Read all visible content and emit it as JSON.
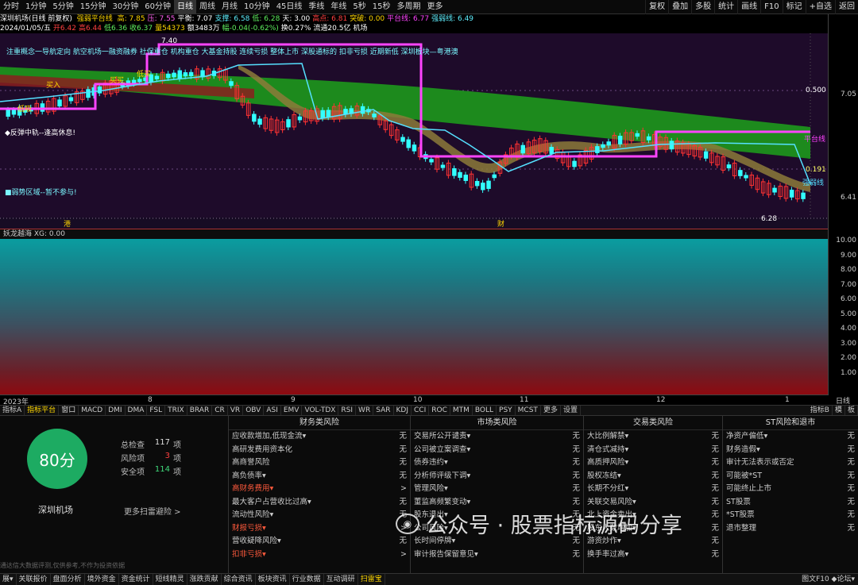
{
  "toolbar": {
    "timeframes": [
      "分时",
      "1分钟",
      "5分钟",
      "15分钟",
      "30分钟",
      "60分钟",
      "日线",
      "周线",
      "月线",
      "10分钟",
      "45日线",
      "季线",
      "年线",
      "5秒",
      "15秒",
      "多周期",
      "更多"
    ],
    "active_timeframe": 6,
    "right_tools": [
      "复权",
      "叠加",
      "多股",
      "统计",
      "画线",
      "F10",
      "标记",
      "+自选",
      "返回"
    ]
  },
  "status_line1": {
    "stock": "深圳机场(日线 前复权)",
    "indicator": "强弱平台线",
    "items": [
      {
        "t": "高: 7.85",
        "c": "#ffd700"
      },
      {
        "t": "压: 7.55",
        "c": "#ff5ff0"
      },
      {
        "t": "平衡: 7.07",
        "c": "#ffffff"
      },
      {
        "t": "支撑: 6.58",
        "c": "#5ff0ff"
      },
      {
        "t": "低: 6.28",
        "c": "#5ff05f"
      },
      {
        "t": "天: 3.00",
        "c": "#ffffff"
      },
      {
        "t": "高点: 6.81",
        "c": "#ff4040"
      },
      {
        "t": "突破: 0.00",
        "c": "#ffd700"
      },
      {
        "t": "平台线: 6.77",
        "c": "#ff44ff"
      },
      {
        "t": "强弱线: 6.49",
        "c": "#5ff0ff"
      }
    ]
  },
  "status_line2": {
    "items": [
      {
        "t": "2024/01/05/五",
        "c": "#ffffff"
      },
      {
        "t": "开6.42",
        "c": "#ff4040"
      },
      {
        "t": "高6.44",
        "c": "#ff4040"
      },
      {
        "t": "低6.36",
        "c": "#5ff05f"
      },
      {
        "t": "收6.37",
        "c": "#5ff05f"
      },
      {
        "t": "量54373",
        "c": "#ffd700"
      },
      {
        "t": "额3483万",
        "c": "#ffffff"
      },
      {
        "t": "幅-0.04(-0.62%)",
        "c": "#5ff05f"
      },
      {
        "t": "换0.27%",
        "c": "#ffffff"
      },
      {
        "t": "流通20.5亿",
        "c": "#ffffff"
      },
      {
        "t": "机场",
        "c": "#ffffff"
      }
    ]
  },
  "main_chart": {
    "y_ticks": [
      "7.05",
      "6.41"
    ],
    "annotations": {
      "hi_price": "7.40",
      "lo_price": "6.28",
      "val_0500": "0.500",
      "val_0191": "0.191",
      "platform_label": "平台线",
      "strong_label": "强弱线",
      "ticker_text": "注重概念一导航定向 航空机场一融资融券 社保重仓 机构重仓 大基金持股 连续亏损 整体上市 深股通标的 扣非亏损 近期新低 深圳板块—粤港澳",
      "rebound_text": "◆反弹中轨--逢高休息!",
      "weak_text": "■弱势区域--暂不参与!",
      "buy1": "低吸",
      "buy2": "买入",
      "buy3": "买买",
      "buy4": "低买",
      "x_mark1": "港",
      "x_mark2": "财"
    }
  },
  "sub_chart": {
    "title": "妖龙越海 XG: 0.00",
    "y_ticks": [
      "10.00",
      "9.00",
      "8.00",
      "7.00",
      "6.00",
      "5.00",
      "4.00",
      "3.00",
      "2.00",
      "1.00"
    ]
  },
  "x_axis": {
    "labels": [
      "2023年",
      "8",
      "9",
      "10",
      "11",
      "12",
      "1"
    ],
    "tag": "日线"
  },
  "indicator_tabs": {
    "items": [
      "指标A",
      "指标平台",
      "窗口",
      "MACD",
      "DMI",
      "DMA",
      "FSL",
      "TRIX",
      "BRAR",
      "CR",
      "VR",
      "OBV",
      "ASI",
      "EMV",
      "VOL-TDX",
      "RSI",
      "WR",
      "SAR",
      "KDJ",
      "CCI",
      "ROC",
      "MTM",
      "BOLL",
      "PSY",
      "MCST",
      "更多",
      "设置"
    ],
    "active": 1,
    "right": [
      "指标B",
      "模",
      "板"
    ]
  },
  "risk_panel": {
    "score": "80分",
    "stock_name": "深圳机场",
    "summary": [
      {
        "label": "总检查",
        "value": "117",
        "unit": "项",
        "color": "#dddddd"
      },
      {
        "label": "风险项",
        "value": "3",
        "unit": "项",
        "color": "#ff4040"
      },
      {
        "label": "安全项",
        "value": "114",
        "unit": "项",
        "color": "#3fd87a"
      }
    ],
    "more_scan": "更多扫雷避险 >",
    "disclaimer": "通达信大数据评测,仅供参考,不作为投资依据",
    "columns": [
      {
        "title": "财务类风险",
        "items": [
          {
            "n": "应收款增加,低现金流▾",
            "v": "无",
            "warn": false
          },
          {
            "n": "高研发费用资本化",
            "v": "无",
            "warn": false
          },
          {
            "n": "高商誉风险",
            "v": "无",
            "warn": false
          },
          {
            "n": "高负债率▾",
            "v": "无",
            "warn": false
          },
          {
            "n": "高财务费用▾",
            "v": ">",
            "warn": true
          },
          {
            "n": "最大客户占营收比过高▾",
            "v": "无",
            "warn": false
          },
          {
            "n": "流动性风险▾",
            "v": "无",
            "warn": false
          },
          {
            "n": "财报亏损▾",
            "v": ">",
            "warn": true
          },
          {
            "n": "营收疑降风险▾",
            "v": "无",
            "warn": false
          },
          {
            "n": "扣非亏损▾",
            "v": ">",
            "warn": true
          }
        ]
      },
      {
        "title": "市场类风险",
        "items": [
          {
            "n": "交易所公开谴责▾",
            "v": "无",
            "warn": false
          },
          {
            "n": "公司被立案调查▾",
            "v": "无",
            "warn": false
          },
          {
            "n": "债券违约▾",
            "v": "无",
            "warn": false
          },
          {
            "n": "分析师评级下调▾",
            "v": "无",
            "warn": false
          },
          {
            "n": "管理风险▾",
            "v": "无",
            "warn": false
          },
          {
            "n": "董监高频繁变动▾",
            "v": "无",
            "warn": false
          },
          {
            "n": "股东退出▾",
            "v": "无",
            "warn": false
          },
          {
            "n": "公司风险▾",
            "v": "无",
            "warn": false
          },
          {
            "n": "长时间停牌▾",
            "v": "无",
            "warn": false
          },
          {
            "n": "审计报告保留意见▾",
            "v": "无",
            "warn": false
          }
        ]
      },
      {
        "title": "交易类风险",
        "items": [
          {
            "n": "大比例解禁▾",
            "v": "无",
            "warn": false
          },
          {
            "n": "清仓式减持▾",
            "v": "无",
            "warn": false
          },
          {
            "n": "高质押风险▾",
            "v": "无",
            "warn": false
          },
          {
            "n": "股权冻结▾",
            "v": "无",
            "warn": false
          },
          {
            "n": "长期不分红▾",
            "v": "无",
            "warn": false
          },
          {
            "n": "关联交易风险▾",
            "v": "无",
            "warn": false
          },
          {
            "n": "北上资金卖出▾",
            "v": "无",
            "warn": false
          },
          {
            "n": "股东人数增加▾",
            "v": "无",
            "warn": false
          },
          {
            "n": "游资炒作▾",
            "v": "无",
            "warn": false
          },
          {
            "n": "换手率过高▾",
            "v": "无",
            "warn": false
          }
        ]
      },
      {
        "title": "ST风险和退市",
        "items": [
          {
            "n": "净资产偏低▾",
            "v": "无",
            "warn": false
          },
          {
            "n": "财务造假▾",
            "v": "无",
            "warn": false
          },
          {
            "n": "审计无法表示或否定",
            "v": "无",
            "warn": false
          },
          {
            "n": "可能被*ST",
            "v": "无",
            "warn": false
          },
          {
            "n": "可能终止上市",
            "v": "无",
            "warn": false
          },
          {
            "n": "ST股票",
            "v": "无",
            "warn": false
          },
          {
            "n": "*ST股票",
            "v": "无",
            "warn": false
          },
          {
            "n": "退市整理",
            "v": "无",
            "warn": false
          }
        ]
      }
    ]
  },
  "watermark": {
    "text": "公众号 · 股票指标源码分享"
  },
  "bottom_bar": {
    "items": [
      "展▾",
      "关联报价",
      "盘面分析",
      "境外资金",
      "资金统计",
      "短线精灵",
      "涨跌贡献",
      "综合资讯",
      "板块资讯",
      "行业数据",
      "互动调研",
      "扫雷宝"
    ],
    "active": 11,
    "right": "图文F10 ◆论坛▾"
  },
  "colors": {
    "up": "#ff3333",
    "down": "#33ffff",
    "platform_line": "#ff44ff",
    "strong_line": "#55e0ff",
    "band": "#1f8a1f",
    "score_green": "#1dab62"
  }
}
